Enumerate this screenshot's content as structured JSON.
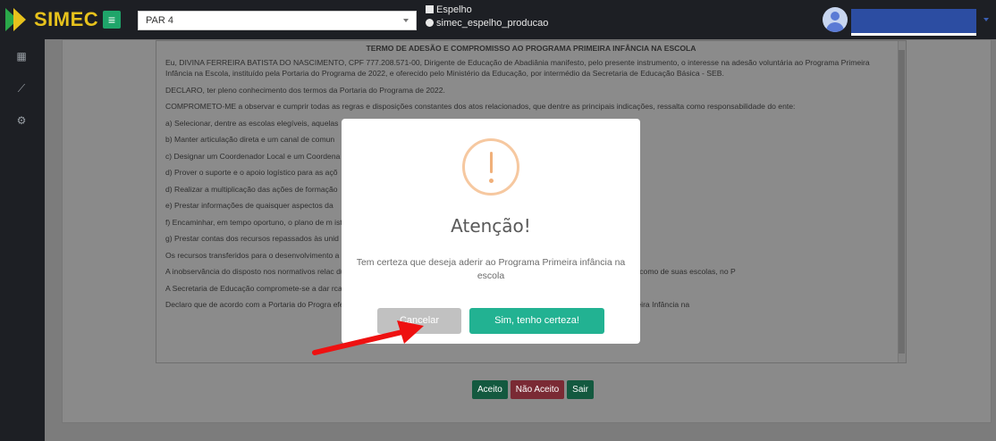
{
  "app": {
    "logo_text": "SIMEC",
    "menu_icon": "hamburger-icon",
    "par_select": "PAR 4",
    "env_name": "Espelho",
    "env_db": "simec_espelho_producao"
  },
  "sidebar": {
    "items": [
      {
        "icon": "grid-icon",
        "glyph": "▦"
      },
      {
        "icon": "chart-icon",
        "glyph": "⟋"
      },
      {
        "icon": "gears-icon",
        "glyph": "⚙"
      }
    ]
  },
  "doc": {
    "title": "TERMO DE ADESÃO E COMPROMISSO AO PROGRAMA PRIMEIRA INFÂNCIA NA ESCOLA",
    "paragraphs": [
      "Eu, DIVINA FERREIRA BATISTA DO NASCIMENTO, CPF 777.208.571-00, Dirigente de Educação de Abadiânia manifesto, pelo presente instrumento, o interesse na adesão voluntária ao Programa Primeira Infância na Escola, instituído pela Portaria do Programa de 2022, e oferecido pelo Ministério da Educação, por intermédio da Secretaria de Educação Básica - SEB.",
      "DECLARO, ter pleno conhecimento dos termos da Portaria do Programa de 2022.",
      "COMPROMETO-ME a observar e cumprir todas as regras e disposições constantes dos atos relacionados, que dentre as principais indicações, ressalta como responsabilidade do ente:",
      "a) Selecionar, dentre as escolas elegíveis, aquelas",
      "b) Manter articulação direta e um canal de comun",
      "c) Designar um Coordenador Local e um Coordena",
      "d) Prover o suporte e o apoio logístico para as açõ",
      "d) Realizar a multiplicação das ações de formação",
      "e) Prestar informações de quaisquer aspectos da",
      "f) Encaminhar, em tempo oportuno, o plano de m                                                                                    istério da Educação:",
      "g) Prestar contas dos recursos repassados às unid",
      "Os recursos transferidos para o desenvolvimento                                                                                   a o fim proposto, e serão explicitados na prestação de contas.",
      "A inobservância do disposto nos normativos relac                                                                                  ducação poderá(ão) implicar o cancelamento da participação do Governo, da SME, bem como de suas escolas, no P",
      "A Secretaria de Educação compromete-se a dar                                                                                      rca do Ministério da Educação e do Governo Federal em tais divulgações.",
      "Declaro que de acordo com a Portaria do Progra                                                                                   efe do Executivo está ciente e concorda conjuntamente com a adesão do Programa Primeira Infância na"
    ]
  },
  "actions": {
    "accept": "Aceito",
    "reject": "Não Aceito",
    "exit": "Sair"
  },
  "modal": {
    "icon": "warning-icon",
    "title": "Atenção!",
    "text": "Tem certeza que deseja aderir ao Programa Primeira infância na escola",
    "cancel": "Cancelar",
    "confirm": "Sim, tenho certeza!"
  },
  "colors": {
    "topbar": "#1d1f24",
    "logo": "#e7c21c",
    "menu_button": "#1fa56a",
    "confirm": "#22b292",
    "cancel": "#c1c1c1",
    "warning": "#f0b07a",
    "arrow": "#ee1111"
  }
}
